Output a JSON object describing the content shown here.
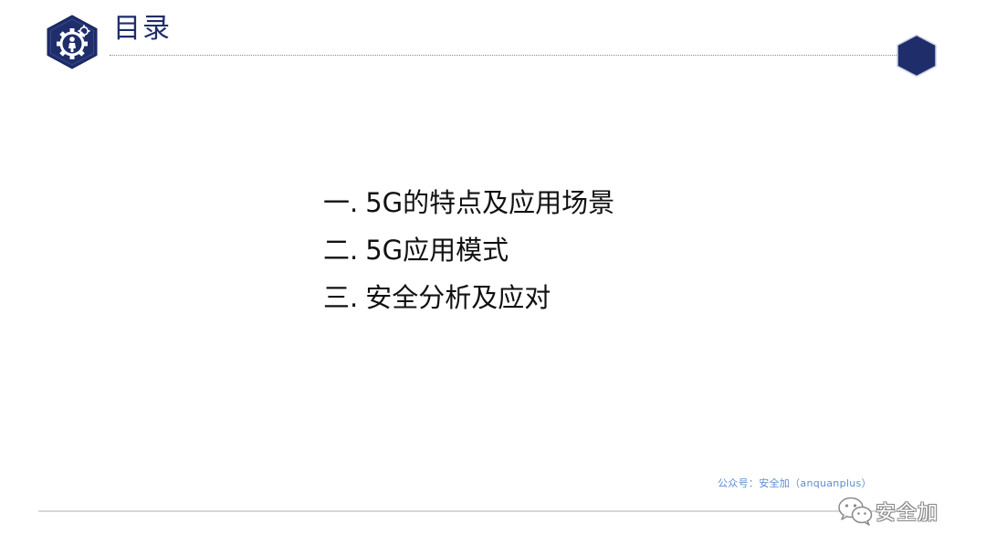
{
  "slide": {
    "title": "目录",
    "toc": [
      {
        "num": "一",
        "label": "5G的特点及应用场景"
      },
      {
        "num": "二",
        "label": "5G应用模式"
      },
      {
        "num": "三",
        "label": "安全分析及应对"
      }
    ],
    "toc_separator": ".",
    "watermark": "公众号：安全加（anquanplus）",
    "wechat_account": "安全加"
  },
  "icons": {
    "logo": "hexagon-gear-person-icon",
    "corner": "hexagon-icon",
    "wechat": "wechat-icon"
  },
  "colors": {
    "navy": "#1f2d6b",
    "watermark_blue": "#5b8ed0",
    "divider_gray": "#d7d7d7"
  }
}
